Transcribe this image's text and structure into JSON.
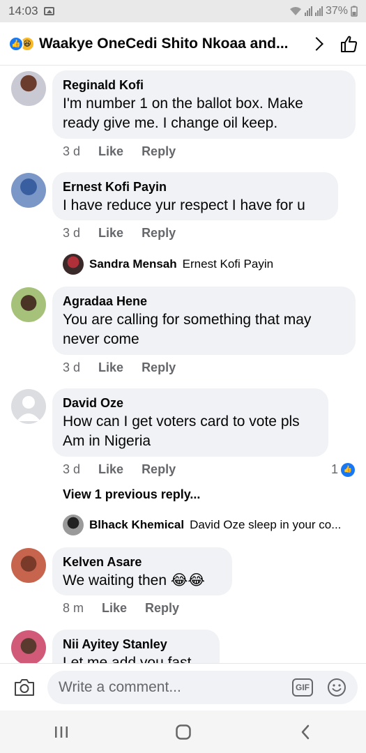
{
  "status_bar": {
    "time": "14:03",
    "battery": "37%"
  },
  "header": {
    "title": "Waakye OneCedi Shito Nkoaa and..."
  },
  "comments": [
    {
      "author": "Reginald Kofi",
      "lines": [
        "I'm number 1 on the ballot box. Make",
        "ready give me. I change oil keep."
      ],
      "time": "3 d",
      "like": "Like",
      "reply": "Reply"
    },
    {
      "author": "Ernest Kofi Payin",
      "lines": [
        "I have reduce yur respect I have for u"
      ],
      "time": "3 d",
      "like": "Like",
      "reply": "Reply",
      "reply_preview": {
        "author": "Sandra Mensah",
        "text": "Ernest Kofi Payin"
      }
    },
    {
      "author": "Agradaa Hene",
      "lines": [
        "You are calling for something that may",
        "never come"
      ],
      "time": "3 d",
      "like": "Like",
      "reply": "Reply"
    },
    {
      "author": "David Oze",
      "lines": [
        "How can I get voters card to vote pls",
        "Am in Nigeria"
      ],
      "time": "3 d",
      "like": "Like",
      "reply": "Reply",
      "like_count": "1",
      "view_previous": "View 1 previous reply...",
      "reply_preview": {
        "author": "Blhack Khemical",
        "text": "David Oze sleep in your co..."
      }
    },
    {
      "author": "Kelven Asare",
      "lines": [
        "We waiting then 😂😂"
      ],
      "time": "8 m",
      "like": "Like",
      "reply": "Reply"
    },
    {
      "author": "Nii Ayitey Stanley",
      "lines": [
        "Let me add you fast"
      ]
    }
  ],
  "composer": {
    "placeholder": "Write a comment...",
    "gif_label": "GIF"
  },
  "icons": {
    "camera": "camera-icon",
    "gif": "gif-icon",
    "emoji": "emoji-icon",
    "like": "thumbs-up-icon",
    "chevron": "chevron-right-icon"
  },
  "colors": {
    "accent": "#1877f2",
    "bubble": "#f0f2f5",
    "muted": "#65676b"
  }
}
